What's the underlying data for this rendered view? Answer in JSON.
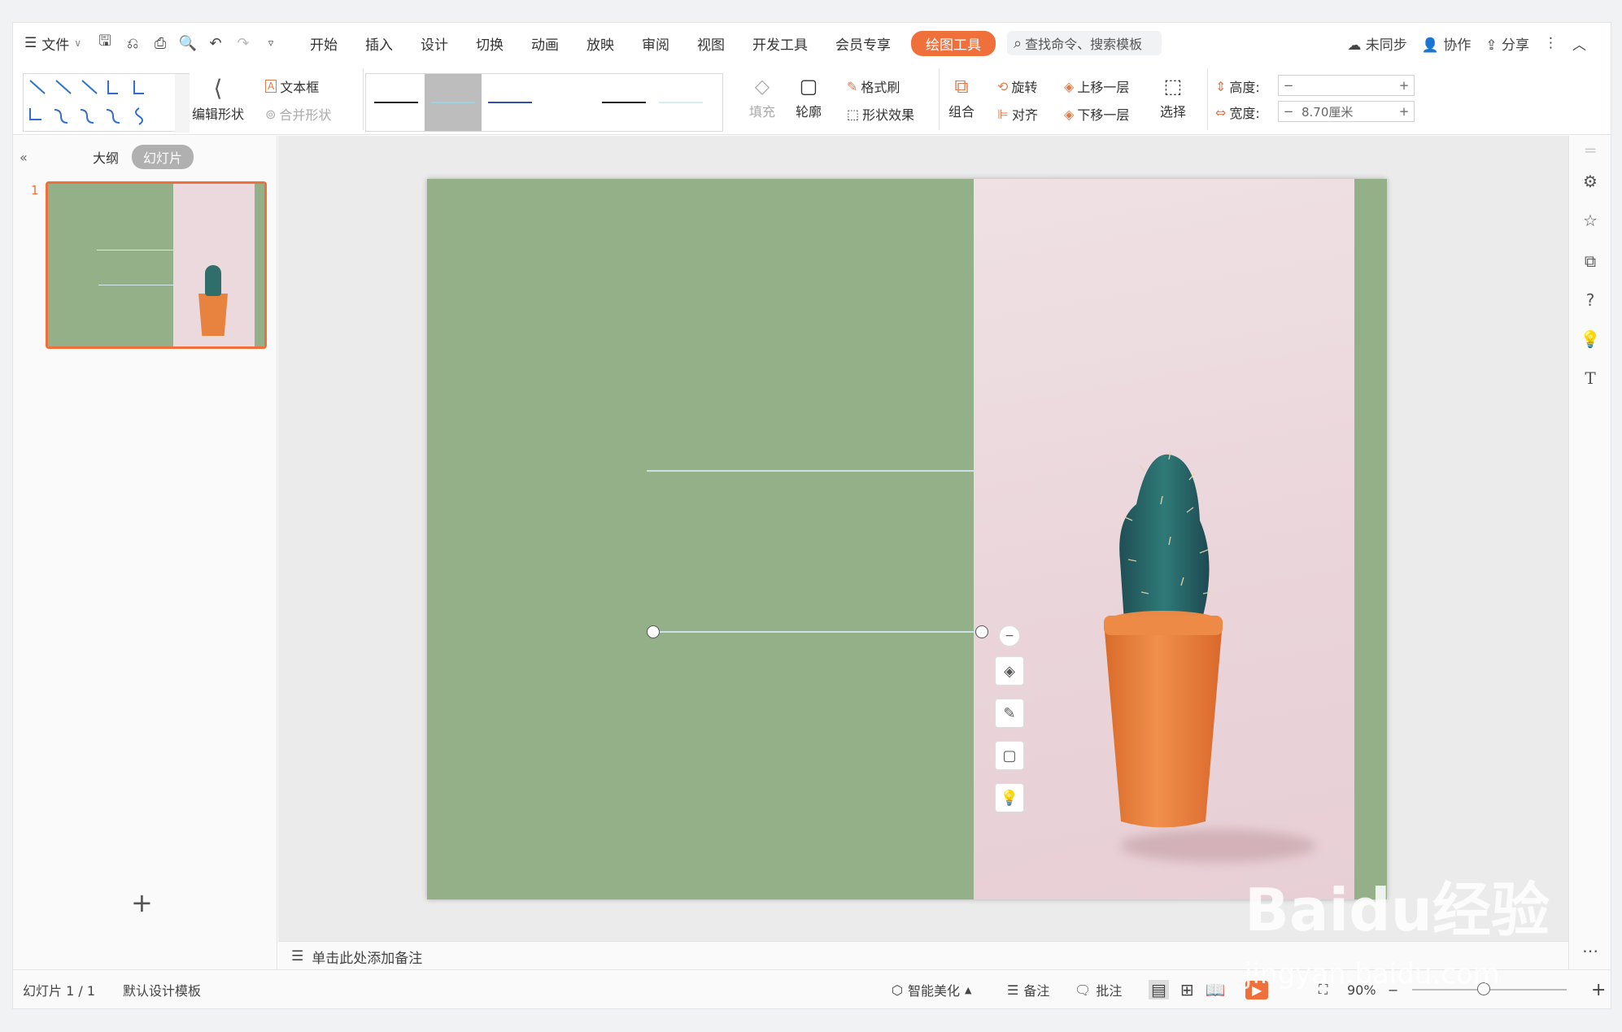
{
  "menu": {
    "file": "文件",
    "tabs": [
      "开始",
      "插入",
      "设计",
      "切换",
      "动画",
      "放映",
      "审阅",
      "视图",
      "开发工具",
      "会员专享"
    ],
    "draw_tab": "绘图工具",
    "search_placeholder": "查找命令、搜索模板",
    "right": {
      "sync": "未同步",
      "collab": "协作",
      "share": "分享"
    }
  },
  "ribbon": {
    "edit_shape": "编辑形状",
    "textbox": "文本框",
    "merge_shape": "合并形状",
    "fill": "填充",
    "outline": "轮廓",
    "format_painter": "格式刷",
    "shape_effects": "形状效果",
    "group": "组合",
    "rotate": "旋转",
    "align": "对齐",
    "bring_forward": "上移一层",
    "send_backward": "下移一层",
    "select": "选择",
    "height_label": "高度:",
    "height_value": "",
    "width_label": "宽度:",
    "width_value": "8.70厘米"
  },
  "leftpane": {
    "outline_tab": "大纲",
    "slides_tab": "幻灯片",
    "slide_number": "1"
  },
  "notes": {
    "placeholder": "单击此处添加备注"
  },
  "status": {
    "slide_indicator": "幻灯片 1 / 1",
    "template": "默认设计模板",
    "beautify": "智能美化",
    "notes": "备注",
    "comments": "批注",
    "zoom": "90%"
  },
  "watermark": {
    "line1": "Baidu经验",
    "line2": "jingyan.baidu.com"
  },
  "colors": {
    "accent": "#f0703c",
    "slide_green": "#93b089",
    "line": "#cde0e4"
  }
}
